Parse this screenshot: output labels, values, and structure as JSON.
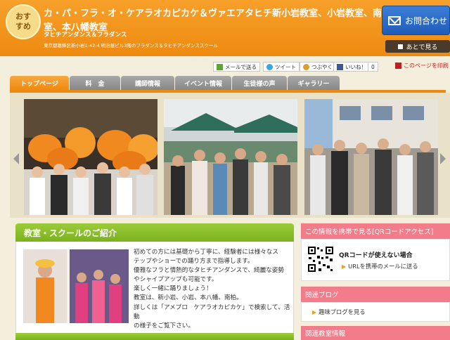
{
  "header": {
    "badge_line1": "おす",
    "badge_line2": "すめ",
    "title_line1": "カ・パ・フラ・オ・ケアラオカピカケ＆ヴァエアタヒチ新小岩教室、小岩教室、南柏教",
    "title_line2": "室、本八幡教室",
    "subtitle": "タヒチアンダンス＆フラダンス",
    "address": "東京都葛飾区新小岩1-42-4 明治屋ビル3階のフラダンス＆タヒチアンダンススクール",
    "contact_label": "お問合わせ",
    "later_label": "あとで見る"
  },
  "social": {
    "mail_label": "メールで送る",
    "tweet_label": "ツイート",
    "mixi_label": "つぶやく",
    "like_label": "いいね！",
    "like_count": "0",
    "print_label": "このページを印刷"
  },
  "nav": {
    "tabs": [
      "トップページ",
      "料　金",
      "講師情報",
      "イベント情報",
      "生徒様の声",
      "ギャラリー"
    ]
  },
  "intro": {
    "heading": "教室・スクールのご紹介",
    "lines": [
      "初めての方には基礎から丁寧に、経験者には様々なス",
      "テップやショーでの踊り方まで指導します。",
      "優雅なフラと情熱的なタヒチアンダンスで、綺麗な姿勢",
      "やシャイプアップも可能です。",
      "楽しく一緒に踊りましょう！",
      "教室は、新小岩、小岩、本八幡、南柏。",
      "詳しくは「アメブロ　ケアラオカピカケ」で検索して、活動",
      "の様子をご覧下さい。"
    ]
  },
  "side": {
    "qr_heading": "この情報を携帯で見る[QRコードアクセス]",
    "qr_title": "QRコードが使えない場合",
    "qr_link": "URLを携帯のメールに送る",
    "blog_heading": "関連ブログ",
    "blog_link": "趣味ブログを見る",
    "school_heading": "関連教室情報"
  },
  "colors": {
    "header_orange": "#ee8a10",
    "contact_blue": "#1f5cb8",
    "green_accent": "#7ab21c",
    "pink_accent": "#f27c8a"
  }
}
